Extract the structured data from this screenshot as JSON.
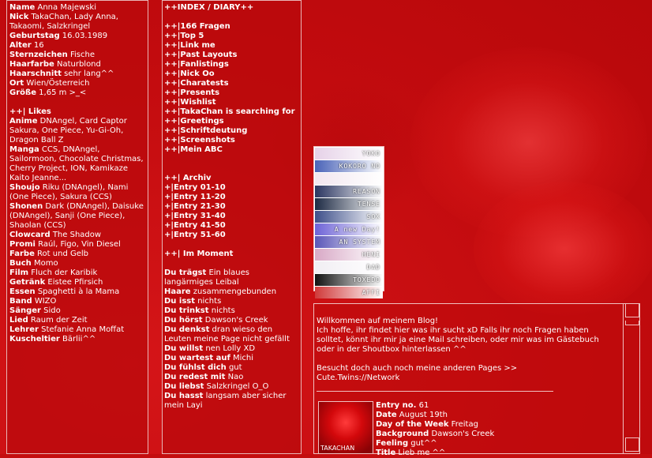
{
  "profile": [
    {
      "k": "Name",
      "v": "Anna Majewski"
    },
    {
      "k": "Nick",
      "v": "TakaChan, Lady Anna, Takaomi, Salzkringel"
    },
    {
      "k": "Geburtstag",
      "v": "16.03.1989"
    },
    {
      "k": "Alter",
      "v": "16"
    },
    {
      "k": "Sternzeichen",
      "v": "Fische"
    },
    {
      "k": "Haarfarbe",
      "v": "Naturblond"
    },
    {
      "k": "Haarschnitt",
      "v": "sehr lang^^"
    },
    {
      "k": "Ort",
      "v": "Wien/Österreich"
    },
    {
      "k": "Größe",
      "v": "1,65 m >_<"
    }
  ],
  "likes_title": "++| Likes",
  "likes": [
    {
      "k": "Anime",
      "v": "DNAngel, Card Captor Sakura, One Piece, Yu-Gi-Oh, Dragon Ball Z"
    },
    {
      "k": "Manga",
      "v": "CCS, DNAngel, Sailormoon, Chocolate Christmas, Cherry Project, ION, Kamikaze Kaito Jeanne..."
    },
    {
      "k": "Shoujo",
      "v": "Riku (DNAngel), Nami (One Piece), Sakura (CCS)"
    },
    {
      "k": "Shonen",
      "v": "Dark (DNAngel), Daisuke (DNAngel), Sanji (One Piece), Shaolan (CCS)"
    },
    {
      "k": "Clowcard",
      "v": "The Shadow"
    },
    {
      "k": "Promi",
      "v": "Raúl, Figo, Vin Diesel"
    },
    {
      "k": "Farbe",
      "v": "Rot und Gelb"
    },
    {
      "k": "Buch",
      "v": "Momo"
    },
    {
      "k": "Film",
      "v": "Fluch der Karibik"
    },
    {
      "k": "Getränk",
      "v": "Eistee Pfirsich"
    },
    {
      "k": "Essen",
      "v": "Spaghetti à la Mama"
    },
    {
      "k": "Band",
      "v": "WIZO"
    },
    {
      "k": "Sänger",
      "v": "Sido"
    },
    {
      "k": "Lied",
      "v": "Raum der Zeit"
    },
    {
      "k": "Lehrer",
      "v": "Stefanie Anna Moffat"
    },
    {
      "k": "Kuscheltier",
      "v": "Bärlii^^"
    }
  ],
  "nav_title": "++INDEX / DIARY++",
  "nav_links": [
    "++|166 Fragen",
    "++|Top 5",
    "++|Link me",
    "++|Past Layouts",
    "++|Fanlistings",
    "++|Nick Oo",
    "++|Charatests",
    "++|Presents",
    "++|Wishlist",
    "++|TakaChan is searching for",
    "++|Greetings",
    "++|Schriftdeutung",
    "++|Screenshots",
    "++|Mein ABC"
  ],
  "archiv_title": "++| Archiv",
  "archiv_links": [
    "+|Entry 01-10",
    "+|Entry 11-20",
    "+|Entry 21-30",
    "+|Entry 31-40",
    "+|Entry 41-50",
    "+|Entry 51-60"
  ],
  "moment_title": "++| Im Moment",
  "moment": [
    {
      "k": "Du trägst",
      "v": "Ein blaues langärmiges Leibal"
    },
    {
      "k": "Haare",
      "v": "zusammengebunden"
    },
    {
      "k": "Du isst",
      "v": "nichts"
    },
    {
      "k": "Du trinkst",
      "v": "nichts"
    },
    {
      "k": "Du hörst",
      "v": "Dawson's Creek"
    },
    {
      "k": "Du denkst",
      "v": "dran wieso den Leuten meine Page nicht gefällt"
    },
    {
      "k": "Du willst",
      "v": "nen Lolly XD"
    },
    {
      "k": "Du wartest auf",
      "v": "Michi"
    },
    {
      "k": "Du fühlst dich",
      "v": "gut"
    },
    {
      "k": "Du redest mit",
      "v": "Nao"
    },
    {
      "k": "Du liebst",
      "v": "Salzkringel O_O"
    },
    {
      "k": "Du hasst",
      "v": "langsam aber sicher mein Layi"
    }
  ],
  "banners": [
    {
      "text": "YOKO",
      "bg": "#e6d2e8"
    },
    {
      "text": "KOKORO NO TSUMETAI",
      "bg": "#4a63b8"
    },
    {
      "text": "",
      "bg": "#f2e6ef"
    },
    {
      "text": "REASON",
      "bg": "#2a3560"
    },
    {
      "text": "TENSE",
      "bg": "#1d2a44"
    },
    {
      "text": "SOX",
      "bg": "#3e4f8a"
    },
    {
      "text": "A new Day!",
      "bg": "#6d62d6"
    },
    {
      "text": "AN SYSTEM",
      "bg": "#5a56b8"
    },
    {
      "text": "HENI",
      "bg": "#d8a9c6"
    },
    {
      "text": "DAD",
      "bg": "#f1eef3"
    },
    {
      "text": "TOXEDO",
      "bg": "#111111"
    },
    {
      "text": "AFFI",
      "bg": "#d03a3a"
    }
  ],
  "blog": {
    "intro1": "Willkommen auf meinem Blog!",
    "intro2": "Ich hoffe, ihr findet hier was ihr sucht xD Falls ihr noch Fragen haben solltet, könnt ihr mir ja eine Mail schreiben, oder mir was im Gästebuch oder in der Shoutbox hinterlassen ^^",
    "intro3": "Besucht doch auch noch meine anderen Pages >>",
    "network": "Cute.Twins://Network",
    "thumb_label": "TAKACHAN",
    "entry": [
      {
        "k": "Entry no.",
        "v": "61"
      },
      {
        "k": "Date",
        "v": "August 19th"
      },
      {
        "k": "Day of the Week",
        "v": "Freitag"
      },
      {
        "k": "Background",
        "v": "Dawson's Creek"
      },
      {
        "k": "Feeling",
        "v": "gut^^"
      },
      {
        "k": "Title",
        "v": "Lieb me ^^"
      }
    ]
  }
}
